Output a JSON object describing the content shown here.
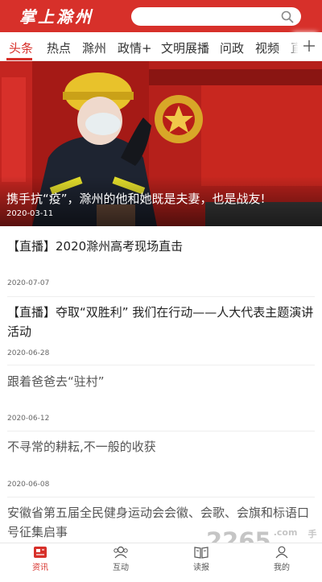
{
  "header": {
    "logo": "掌上滁州",
    "search_placeholder": ""
  },
  "tabs": [
    {
      "label": "头条",
      "active": true
    },
    {
      "label": "热点"
    },
    {
      "label": "滁州"
    },
    {
      "label": "政情+"
    },
    {
      "label": "文明展播"
    },
    {
      "label": "问政"
    },
    {
      "label": "视频"
    },
    {
      "label": "直"
    }
  ],
  "banner": {
    "title": "携手抗“疫”，滁州的他和她既是夫妻，也是战友!",
    "date": "2020-03-11",
    "slides": 3,
    "active_slide": 2
  },
  "news": [
    {
      "title": "【直播】2020滁州高考现场直击",
      "date": "2020-07-07"
    },
    {
      "title": "【直播】夺取“双胜利” 我们在行动——人大代表主题演讲活动",
      "date": "2020-06-28"
    },
    {
      "title": "跟着爸爸去“驻村”",
      "date": "2020-06-12"
    },
    {
      "title": "不寻常的耕耘,不一般的收获",
      "date": "2020-06-08"
    },
    {
      "title": "安徽省第五届全民健身运动会会徽、会歌、会旗和标语口号征集启事",
      "date": ""
    }
  ],
  "bottom_nav": [
    {
      "label": "资讯",
      "icon": "news-icon",
      "active": true
    },
    {
      "label": "互动",
      "icon": "people-icon"
    },
    {
      "label": "读报",
      "icon": "book-icon"
    },
    {
      "label": "我的",
      "icon": "user-icon"
    }
  ],
  "watermark": {
    "main": "2265",
    "suffix": ".com",
    "sub": "手游网"
  },
  "colors": {
    "brand": "#d7302a",
    "active_tab": "#d7302a"
  }
}
